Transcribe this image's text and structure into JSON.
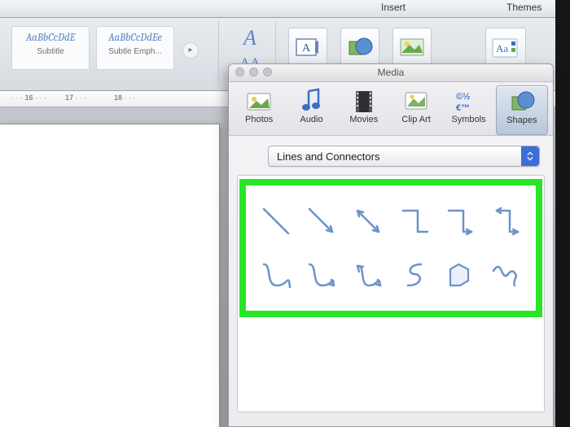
{
  "ribbon": {
    "tabs": {
      "insert": "Insert",
      "themes": "Themes"
    },
    "styles": [
      {
        "sample": "AaBbCcDdE",
        "name": "Subtitle"
      },
      {
        "sample": "AaBbCcDdEe",
        "name": "Subtle Emph..."
      }
    ]
  },
  "ruler": {
    "marks": [
      "16",
      "17",
      "18"
    ]
  },
  "media": {
    "title": "Media",
    "tabs": [
      {
        "label": "Photos",
        "icon": "photos-icon"
      },
      {
        "label": "Audio",
        "icon": "audio-icon"
      },
      {
        "label": "Movies",
        "icon": "movies-icon"
      },
      {
        "label": "Clip Art",
        "icon": "clip-art-icon"
      },
      {
        "label": "Symbols",
        "icon": "symbols-icon"
      },
      {
        "label": "Shapes",
        "icon": "shapes-icon"
      }
    ],
    "selected_tab": "Shapes",
    "category": "Lines and Connectors",
    "shapes": [
      "line",
      "line-arrow",
      "line-double-arrow",
      "elbow-connector",
      "elbow-arrow",
      "elbow-double-arrow",
      "curve",
      "curve-arrow",
      "curve-double-arrow",
      "s-curve",
      "freeform",
      "scribble"
    ]
  }
}
